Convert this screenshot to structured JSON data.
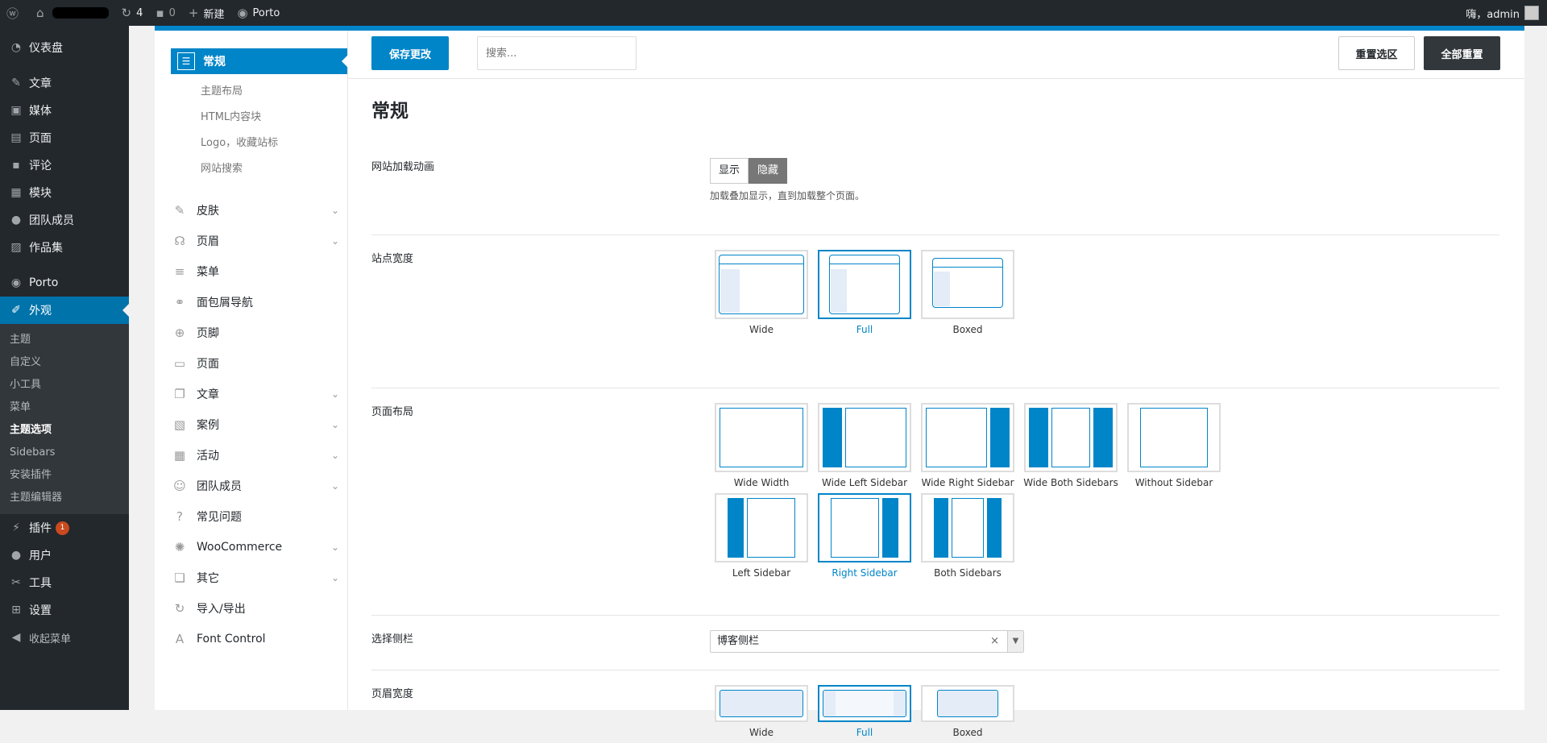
{
  "adminbar": {
    "updates": "4",
    "comments": "0",
    "new": "新建",
    "site": "Porto",
    "greeting": "嗨，admin"
  },
  "sidebar": {
    "items": [
      {
        "label": "仪表盘"
      },
      {
        "label": "文章"
      },
      {
        "label": "媒体"
      },
      {
        "label": "页面"
      },
      {
        "label": "评论"
      },
      {
        "label": "模块"
      },
      {
        "label": "团队成员"
      },
      {
        "label": "作品集"
      },
      {
        "label": "Porto"
      },
      {
        "label": "外观"
      },
      {
        "label": "插件",
        "badge": "1"
      },
      {
        "label": "用户"
      },
      {
        "label": "工具"
      },
      {
        "label": "设置"
      },
      {
        "label": "收起菜单"
      }
    ],
    "sub": [
      "主题",
      "自定义",
      "小工具",
      "菜单",
      "主题选项",
      "Sidebars",
      "安装插件",
      "主题编辑器"
    ]
  },
  "pnav": {
    "active": "常规",
    "subs": [
      "主题布局",
      "HTML内容块",
      "Logo，收藏站标",
      "网站搜索"
    ],
    "items": [
      "皮肤",
      "页眉",
      "菜单",
      "面包屑导航",
      "页脚",
      "页面",
      "文章",
      "案例",
      "活动",
      "团队成员",
      "常见问题",
      "WooCommerce",
      "其它",
      "导入/导出",
      "Font Control"
    ]
  },
  "toolbar": {
    "save": "保存更改",
    "search_placeholder": "搜索...",
    "reset_section": "重置选区",
    "reset_all": "全部重置"
  },
  "main": {
    "title": "常规",
    "loading": {
      "label": "网站加载动画",
      "show": "显示",
      "hide": "隐藏",
      "desc": "加载叠加显示，直到加载整个页面。"
    },
    "site_width": {
      "label": "站点宽度",
      "options": [
        "Wide",
        "Full",
        "Boxed"
      ]
    },
    "page_layout": {
      "label": "页面布局",
      "options": [
        "Wide Width",
        "Wide Left Sidebar",
        "Wide Right Sidebar",
        "Wide Both Sidebars",
        "Without Sidebar",
        "Left Sidebar",
        "Right Sidebar",
        "Both Sidebars"
      ]
    },
    "select_sidebar": {
      "label": "选择侧栏",
      "value": "博客侧栏"
    },
    "header_width": {
      "label": "页眉宽度",
      "options": [
        "Wide",
        "Full",
        "Boxed"
      ]
    }
  }
}
